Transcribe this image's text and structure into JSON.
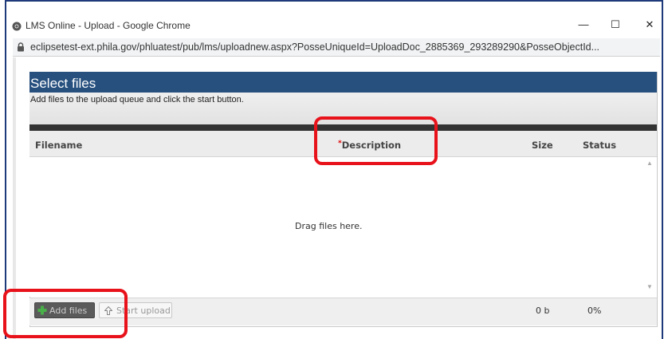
{
  "window": {
    "title": "LMS Online - Upload - Google Chrome",
    "minimize": "—",
    "maximize": "☐",
    "close": "✕",
    "url": "eclipsetest-ext.phila.gov/phluatest/pub/lms/uploadnew.aspx?PosseUniqueId=UploadDoc_2885369_293289290&PosseObjectId..."
  },
  "uploader": {
    "title": "Select files",
    "instructions": "Add files to the upload queue and click the start button.",
    "columns": {
      "filename": "Filename",
      "description_required_mark": "*",
      "description": "Description",
      "size": "Size",
      "status": "Status"
    },
    "drop_text": "Drag files here.",
    "add_files": "Add files",
    "start_upload": "Start upload",
    "total_size": "0 b",
    "total_status": "0%"
  },
  "colors": {
    "header_band": "#27507f",
    "highlight": "#e8121b",
    "required_mark": "#e00000"
  },
  "icons": [
    "chrome-icon",
    "lock-icon",
    "plus-icon",
    "arrow-up-icon"
  ]
}
